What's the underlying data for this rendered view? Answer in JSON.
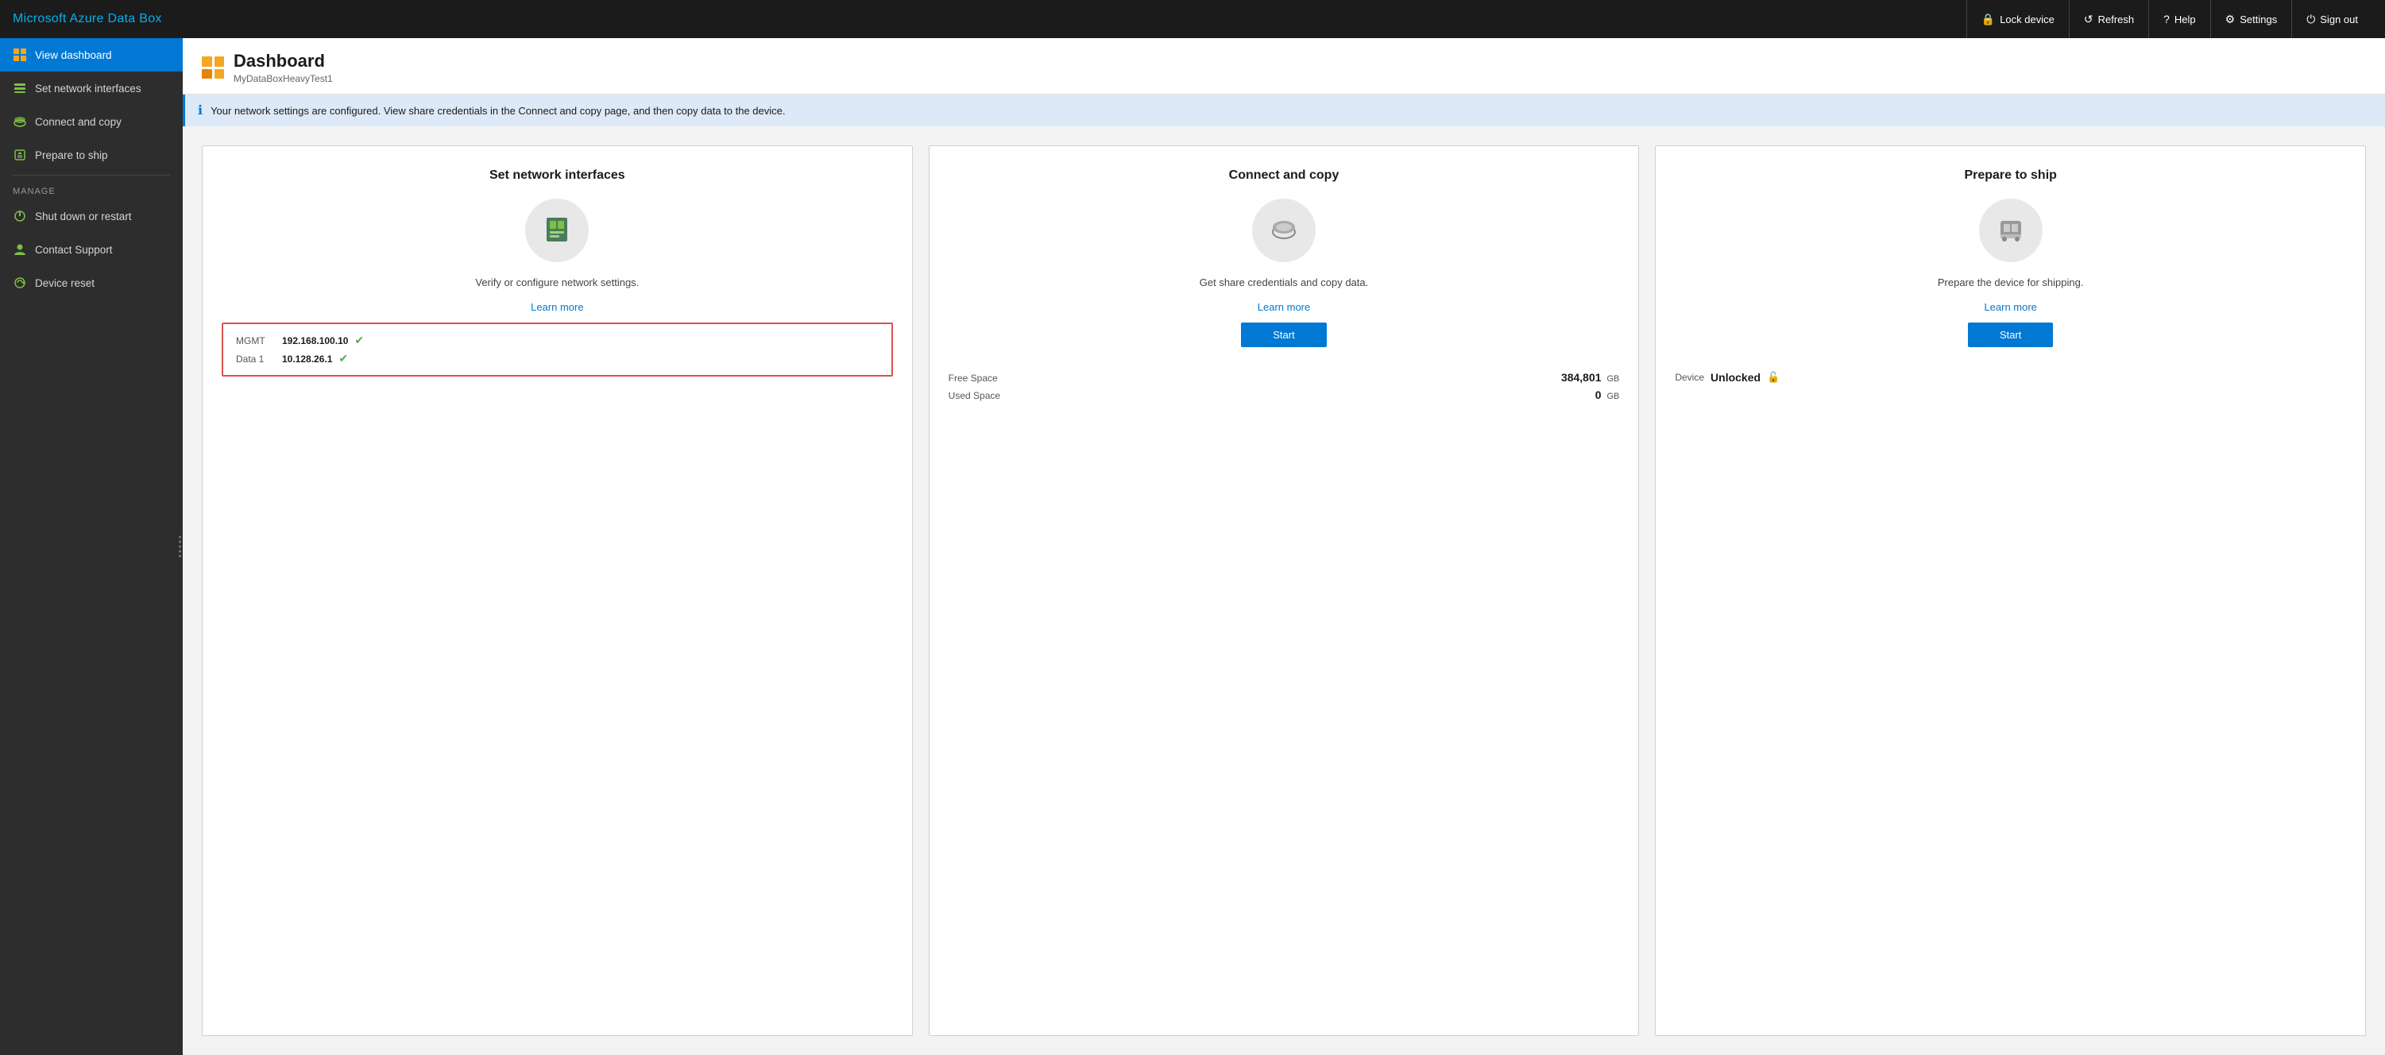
{
  "app": {
    "title": "Microsoft Azure Data Box"
  },
  "topnav": {
    "lock_label": "Lock device",
    "refresh_label": "Refresh",
    "help_label": "Help",
    "settings_label": "Settings",
    "signout_label": "Sign out"
  },
  "sidebar": {
    "nav_items": [
      {
        "id": "view-dashboard",
        "label": "View dashboard",
        "active": true
      },
      {
        "id": "set-network",
        "label": "Set network interfaces",
        "active": false
      },
      {
        "id": "connect-copy",
        "label": "Connect and copy",
        "active": false
      },
      {
        "id": "prepare-ship",
        "label": "Prepare to ship",
        "active": false
      }
    ],
    "manage_label": "MANAGE",
    "manage_items": [
      {
        "id": "shutdown-restart",
        "label": "Shut down or restart",
        "active": false
      },
      {
        "id": "contact-support",
        "label": "Contact Support",
        "active": false
      },
      {
        "id": "device-reset",
        "label": "Device reset",
        "active": false
      }
    ]
  },
  "page": {
    "title": "Dashboard",
    "subtitle": "MyDataBoxHeavyTest1",
    "info_message": "Your network settings are configured. View share credentials in the Connect and copy page, and then copy data to the device."
  },
  "cards": {
    "network": {
      "title": "Set network interfaces",
      "description": "Verify or configure network settings.",
      "learn_more": "Learn more",
      "interfaces": [
        {
          "name": "MGMT",
          "ip": "192.168.100.10",
          "connected": true
        },
        {
          "name": "Data 1",
          "ip": "10.128.26.1",
          "connected": true
        }
      ]
    },
    "copy": {
      "title": "Connect and copy",
      "description": "Get share credentials and copy data.",
      "learn_more": "Learn more",
      "start_label": "Start",
      "free_space_label": "Free Space",
      "free_space_value": "384,801",
      "free_space_unit": "GB",
      "used_space_label": "Used Space",
      "used_space_value": "0",
      "used_space_unit": "GB"
    },
    "ship": {
      "title": "Prepare to ship",
      "description": "Prepare the device for shipping.",
      "learn_more": "Learn more",
      "start_label": "Start",
      "device_label": "Device",
      "device_status": "Unlocked"
    }
  }
}
